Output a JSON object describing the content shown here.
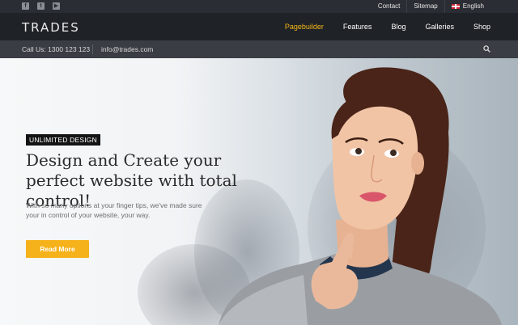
{
  "topbar": {
    "social_icons": [
      "facebook-icon",
      "twitter-icon",
      "youtube-icon"
    ],
    "links": [
      {
        "label": "Contact"
      },
      {
        "label": "Sitemap"
      },
      {
        "label": "English"
      }
    ]
  },
  "nav": {
    "logo": "TRADES",
    "items": [
      {
        "label": "Pagebuilder",
        "active": true
      },
      {
        "label": "Features",
        "active": false
      },
      {
        "label": "Blog",
        "active": false
      },
      {
        "label": "Galleries",
        "active": false
      },
      {
        "label": "Shop",
        "active": false
      }
    ]
  },
  "contact": {
    "phone": "Call Us: 1300 123 123",
    "email": "info@trades.com"
  },
  "hero": {
    "badge": "UNLIMITED DESIGN",
    "headline": "Design and Create your perfect website with total control!",
    "subtext": "With so many options at your finger tips, we've made sure your in control of your website, your way.",
    "button": "Read More"
  },
  "colors": {
    "accent": "#f7b818",
    "button": "#f6b21b",
    "nav_bg": "#1f2227",
    "topbar_bg": "#2a2d33",
    "contact_bg": "#3a3d44"
  }
}
